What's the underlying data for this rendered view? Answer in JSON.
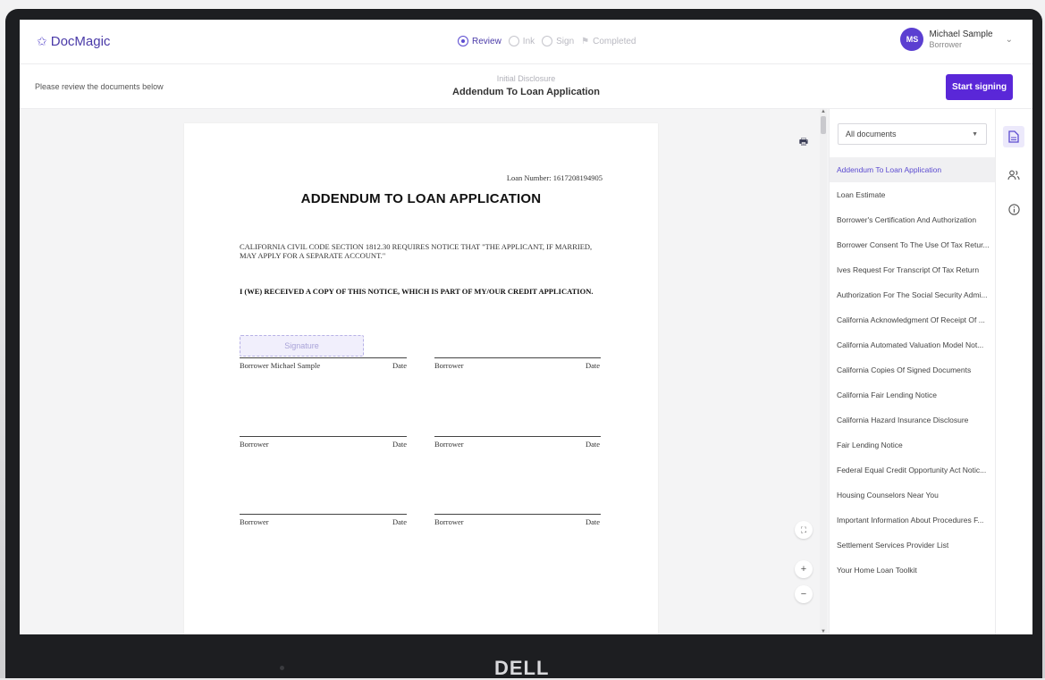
{
  "app": {
    "logo_text": "DocMagic",
    "steps": [
      {
        "label": "Review",
        "active": true
      },
      {
        "label": "Ink",
        "active": false
      },
      {
        "label": "Sign",
        "active": false
      },
      {
        "label": "Completed",
        "active": false
      }
    ],
    "user": {
      "initials": "MS",
      "name": "Michael Sample",
      "role": "Borrower"
    }
  },
  "subbar": {
    "review_text": "Please review the documents below",
    "doc_category": "Initial Disclosure",
    "doc_title": "Addendum To Loan Application",
    "start_button": "Start signing"
  },
  "document": {
    "loan_number": "Loan Number: 1617208194905",
    "heading": "ADDENDUM TO LOAN APPLICATION",
    "notice": "CALIFORNIA CIVIL CODE SECTION 1812.30 REQUIRES NOTICE THAT \"THE APPLICANT, IF MARRIED, MAY APPLY FOR A SEPARATE ACCOUNT.\"",
    "received": "I (WE) RECEIVED A COPY OF THIS NOTICE, WHICH IS PART OF MY/OUR CREDIT APPLICATION.",
    "signature_placeholder": "Signature",
    "signature_rows": [
      {
        "left": "Borrower Michael Sample",
        "left_date": "Date",
        "right": "Borrower",
        "right_date": "Date"
      },
      {
        "left": "Borrower",
        "left_date": "Date",
        "right": "Borrower",
        "right_date": "Date"
      },
      {
        "left": "Borrower",
        "left_date": "Date",
        "right": "Borrower",
        "right_date": "Date"
      }
    ]
  },
  "sidebar": {
    "filter_value": "All documents",
    "documents": [
      "Addendum To Loan Application",
      "Loan Estimate",
      "Borrower's Certification And Authorization",
      "Borrower Consent To The Use Of Tax Retur...",
      "Ives Request For Transcript Of Tax Return",
      "Authorization For The Social Security Admi...",
      "California Acknowledgment Of Receipt Of ...",
      "California Automated Valuation Model Not...",
      "California Copies Of Signed Documents",
      "California Fair Lending Notice",
      "California Hazard Insurance Disclosure",
      "Fair Lending Notice",
      "Federal Equal Credit Opportunity Act Notic...",
      "Housing Counselors Near You",
      "Important Information About Procedures F...",
      "Settlement Services Provider List",
      "Your Home Loan Toolkit"
    ],
    "active_index": 0
  },
  "device": {
    "brand": "DELL"
  },
  "colors": {
    "accent": "#5a27d8",
    "brand": "#4a3aa8"
  }
}
